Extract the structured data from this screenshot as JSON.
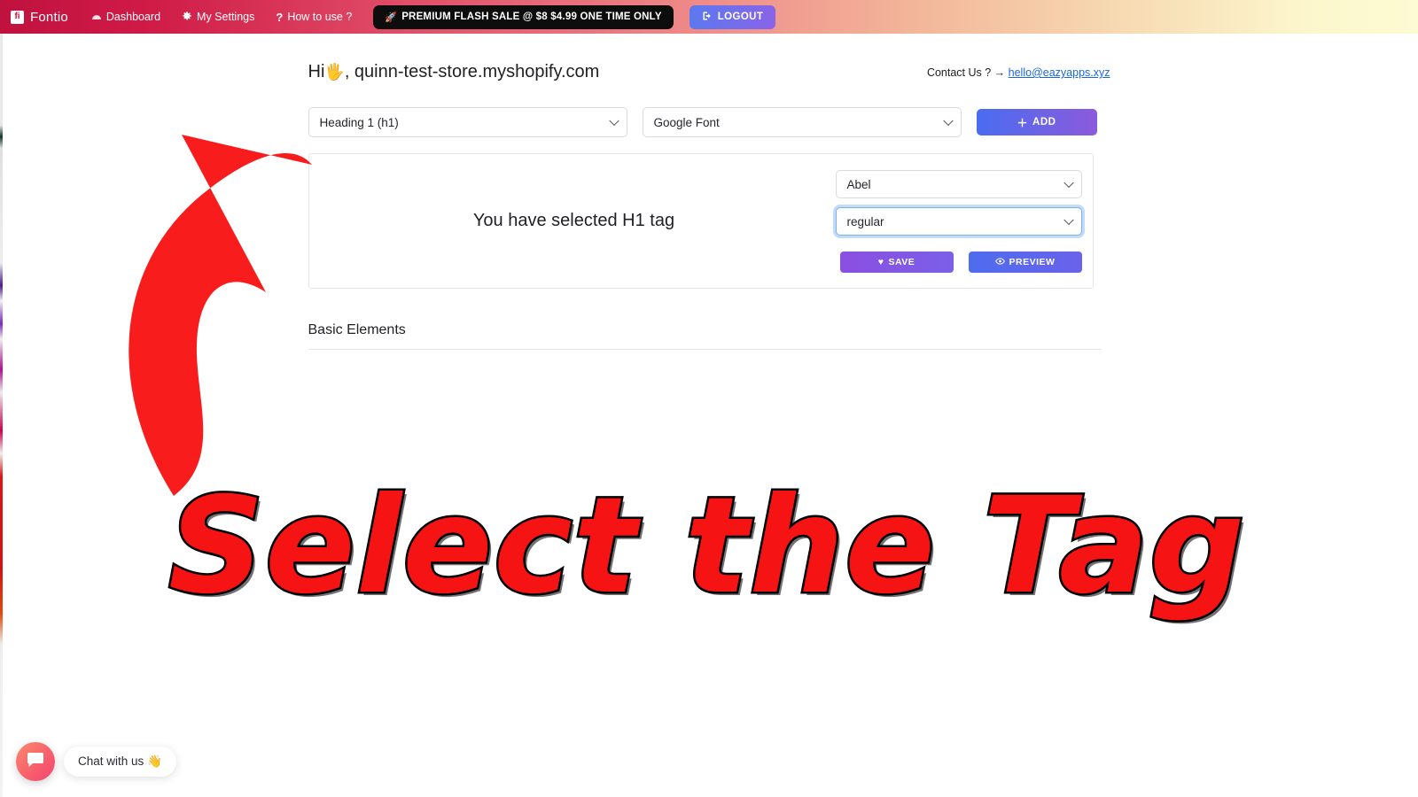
{
  "navbar": {
    "brand": {
      "icon": "fontio-logo-icon",
      "glyph": "fi",
      "name": "Fontio"
    },
    "links": [
      {
        "icon": "dashboard-icon",
        "glyph": "⛅",
        "label": "Dashboard"
      },
      {
        "icon": "gear-icon",
        "glyph": "⚙",
        "label": "My Settings"
      },
      {
        "icon": "question-icon",
        "glyph": "❓",
        "label": "How to use ?"
      }
    ],
    "flash_sale": {
      "icon": "rocket-icon",
      "glyph": "🚀",
      "label": "PREMIUM FLASH SALE @ $8 $4.99 ONE TIME ONLY"
    },
    "logout": {
      "icon": "logout-icon",
      "glyph": "⇥",
      "label": "LOGOUT"
    },
    "gradient_start": "#c0123f",
    "gradient_end": "#fdfbd4"
  },
  "header": {
    "greeting_prefix": "Hi",
    "wave_emoji": "🖐",
    "store": ", quinn-test-store.myshopify.com",
    "contact_label": "Contact Us ? →",
    "contact_email": "hello@eazyapps.xyz",
    "contact_link_color": "#1a66dd"
  },
  "selectors": {
    "tag_select": {
      "value": "Heading 1 (h1)"
    },
    "font_select": {
      "value": "Google Font"
    },
    "add_button": {
      "icon": "plus-icon",
      "glyph": "＋",
      "label": "ADD"
    }
  },
  "card": {
    "preview_text": "You have selected H1 tag",
    "font_family_select": {
      "value": "Abel"
    },
    "font_weight_select": {
      "value": "regular",
      "focused": true
    },
    "save_button": {
      "icon": "heart-icon",
      "glyph": "♥",
      "label": "SAVE"
    },
    "preview_button": {
      "icon": "eye-icon",
      "glyph": "◉",
      "label": "PREVIEW"
    }
  },
  "basic_elements": {
    "title": "Basic Elements"
  },
  "annotation": {
    "caption": "Select the Tag",
    "caption_color": "#f51313",
    "arrow_color": "#f91c1c",
    "arrow_name": "curved-up-right-arrow"
  },
  "chat_widget": {
    "icon": "chat-bubble-icon",
    "label": "Chat with us 👋"
  }
}
